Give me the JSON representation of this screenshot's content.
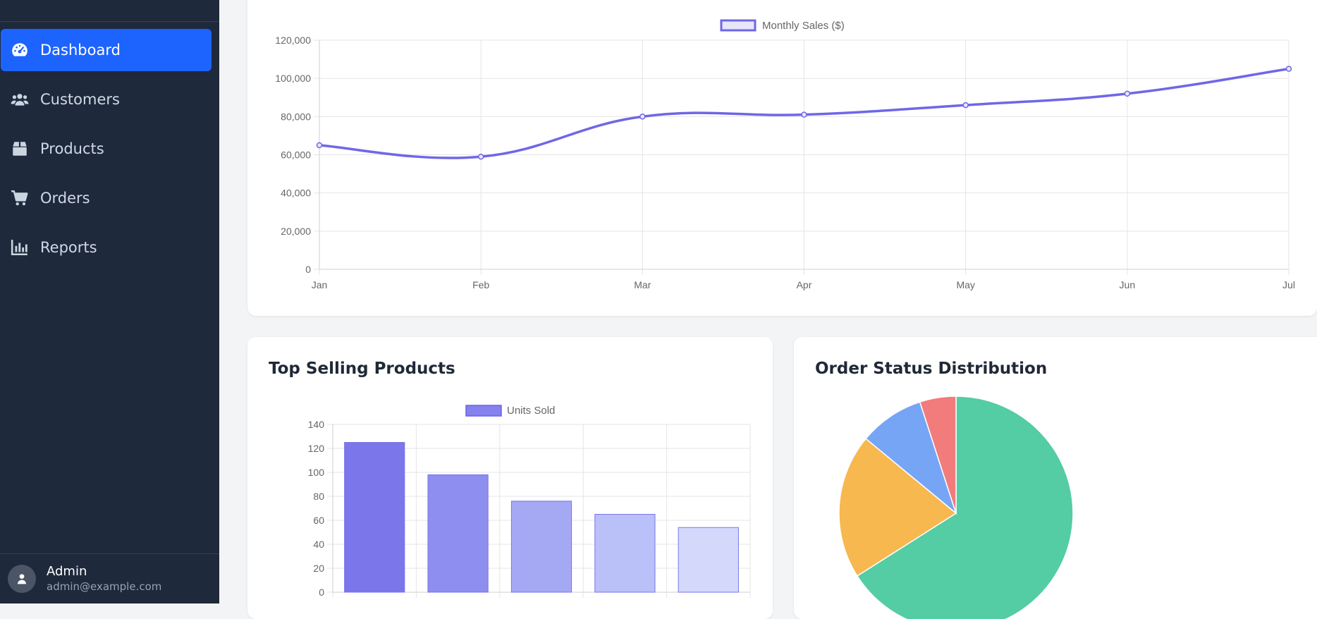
{
  "sidebar": {
    "items": [
      {
        "label": "Dashboard",
        "icon": "gauge-icon",
        "active": true
      },
      {
        "label": "Customers",
        "icon": "users-icon",
        "active": false
      },
      {
        "label": "Products",
        "icon": "box-icon",
        "active": false
      },
      {
        "label": "Orders",
        "icon": "cart-icon",
        "active": false
      },
      {
        "label": "Reports",
        "icon": "bar-chart-icon",
        "active": false
      }
    ],
    "user": {
      "name": "Admin",
      "email": "admin@example.com"
    }
  },
  "cards": {
    "products_title": "Top Selling Products",
    "status_title": "Order Status Distribution"
  },
  "chart_data": [
    {
      "type": "line",
      "legend": "Monthly Sales ($)",
      "categories": [
        "Jan",
        "Feb",
        "Mar",
        "Apr",
        "May",
        "Jun",
        "Jul"
      ],
      "values": [
        65000,
        59000,
        80000,
        81000,
        86000,
        92000,
        105000
      ],
      "ylim": [
        0,
        120000
      ],
      "yticks": [
        "0",
        "20,000",
        "40,000",
        "60,000",
        "80,000",
        "100,000",
        "120,000"
      ],
      "color": "#6f67e6",
      "grid": true,
      "legend_position": "top"
    },
    {
      "type": "bar",
      "legend": "Units Sold",
      "values": [
        125,
        98,
        76,
        65,
        54
      ],
      "ylim": [
        0,
        140
      ],
      "yticks": [
        "0",
        "20",
        "40",
        "60",
        "80",
        "100",
        "120",
        "140"
      ],
      "colors": [
        "#7b76ea",
        "#8e8df0",
        "#a5a9f4",
        "#bac0f8",
        "#d4d9fb"
      ],
      "grid": true,
      "legend_position": "top"
    },
    {
      "type": "pie",
      "values": [
        66,
        20,
        9,
        5
      ],
      "colors": [
        "#54cca4",
        "#f6b84f",
        "#76a5f5",
        "#f27b7b"
      ]
    }
  ]
}
